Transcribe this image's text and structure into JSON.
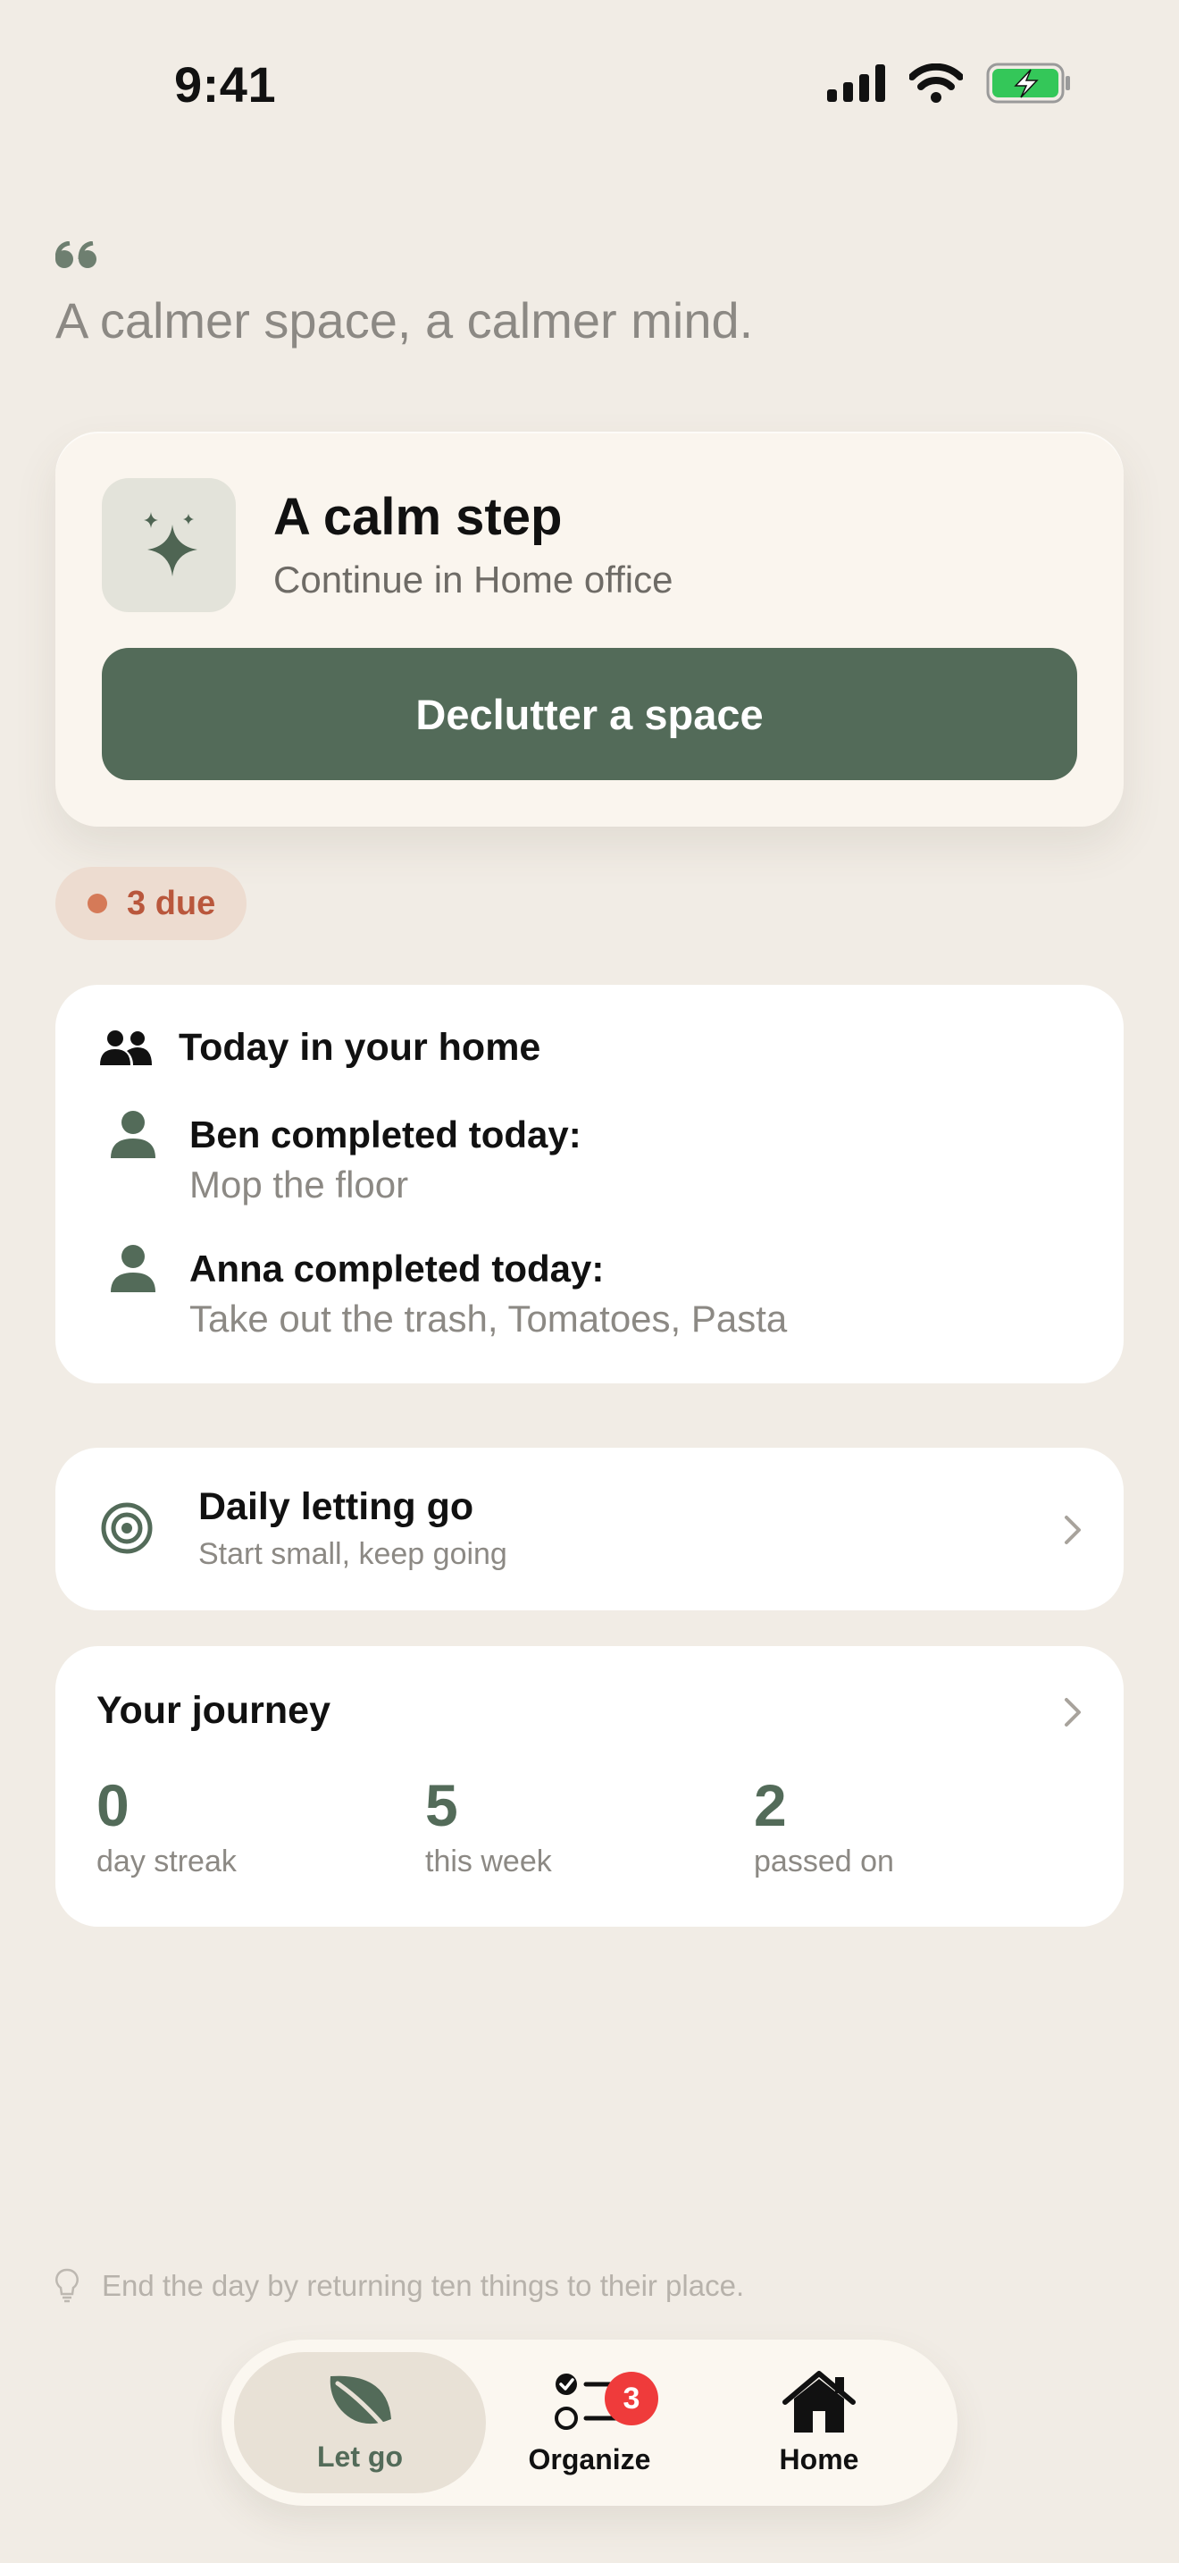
{
  "status_bar": {
    "time": "9:41"
  },
  "quote": {
    "text": "A calmer space, a calmer mind."
  },
  "calm_step": {
    "title": "A calm step",
    "subtitle": "Continue in Home office",
    "button_label": "Declutter a space"
  },
  "due": {
    "label": "3 due"
  },
  "home_activity": {
    "title": "Today in your home",
    "items": [
      {
        "who": "Ben completed today:",
        "what": "Mop the floor"
      },
      {
        "who": "Anna completed today:",
        "what": "Take out the trash, Tomatoes, Pasta"
      }
    ]
  },
  "daily_letting_go": {
    "title": "Daily letting go",
    "subtitle": "Start small, keep going"
  },
  "journey": {
    "title": "Your journey",
    "stats": [
      {
        "value": "0",
        "label": "day streak"
      },
      {
        "value": "5",
        "label": "this week"
      },
      {
        "value": "2",
        "label": "passed on"
      }
    ]
  },
  "tip": {
    "text": "End the day by returning ten things to their place."
  },
  "tabbar": {
    "tabs": [
      {
        "label": "Let go",
        "icon": "leaf-icon",
        "active": true
      },
      {
        "label": "Organize",
        "icon": "checklist-icon",
        "badge": "3"
      },
      {
        "label": "Home",
        "icon": "house-icon"
      }
    ]
  },
  "colors": {
    "background": "#F1ECE5",
    "accent_green": "#536B59",
    "due_text": "#B9573C",
    "badge_red": "#EF3B3B",
    "battery_green": "#34C759"
  }
}
